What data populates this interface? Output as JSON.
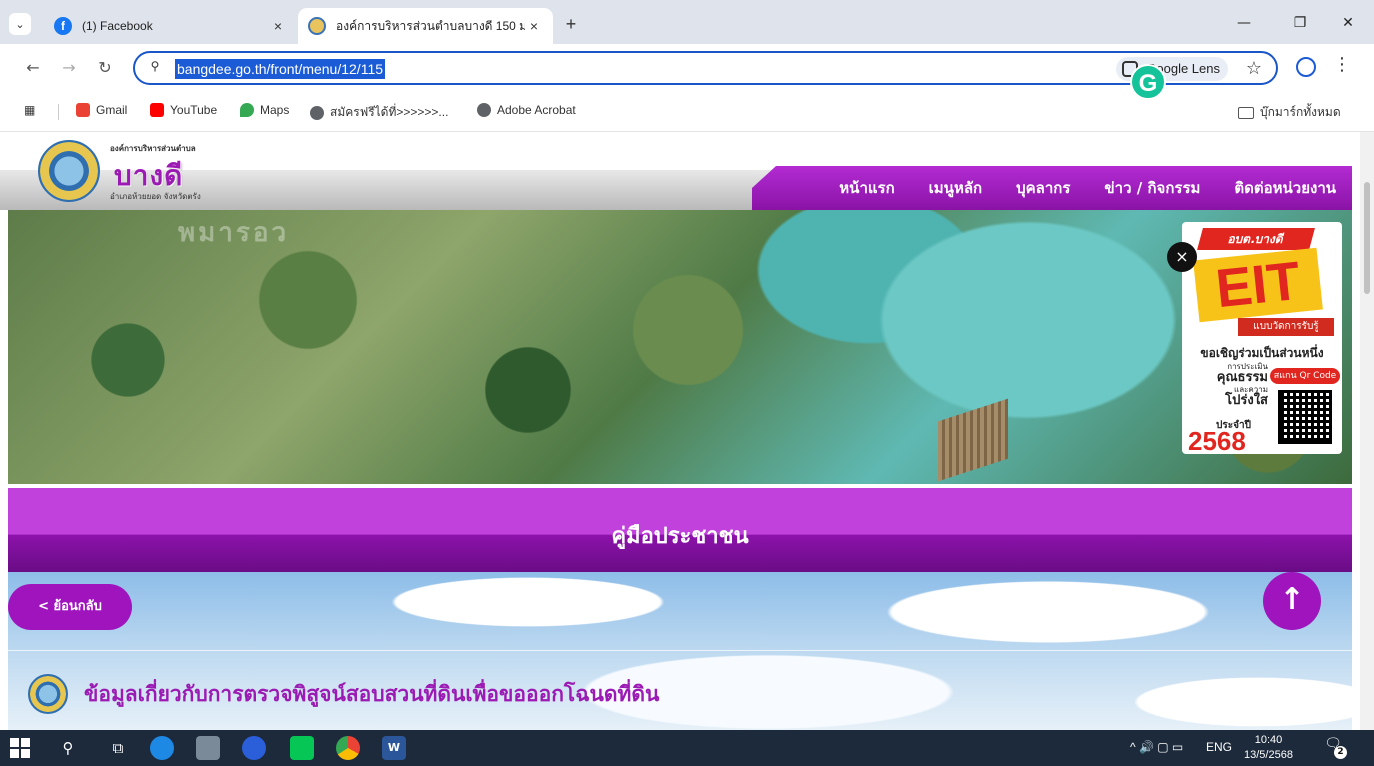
{
  "browser": {
    "tabs": [
      {
        "title": "(1) Facebook",
        "favicon": "facebook-icon",
        "active": false
      },
      {
        "title": "องค์การบริหารส่วนตำบลบางดี 150 ม",
        "favicon": "site-seal-icon",
        "active": true
      }
    ],
    "tab_close_glyph": "×",
    "new_tab_glyph": "+",
    "url": "bangdee.go.th/front/menu/12/115",
    "lens_label": "Google Lens",
    "bookmarks": [
      {
        "label": "Gmail",
        "color": "#ea4335"
      },
      {
        "label": "YouTube",
        "color": "#ff0000"
      },
      {
        "label": "Maps",
        "color": "#34a853"
      },
      {
        "label": "สมัครฟรีได้ที่>>>>>>...",
        "color": "#5f6368"
      },
      {
        "label": "Adobe Acrobat",
        "color": "#5f6368"
      }
    ],
    "all_bookmarks_label": "บุ๊กมาร์กทั้งหมด"
  },
  "site": {
    "logo_org": "องค์การบริหารส่วนตำบล",
    "logo_name": "บางดี",
    "logo_sub": "อำเภอห้วยยอด จังหวัดตรัง",
    "menu": [
      "หน้าแรก",
      "เมนูหลัก",
      "บุคลากร",
      "ข่าว / กิจกรรม",
      "ติดต่อหน่วยงาน"
    ],
    "accent_color": "#a014be",
    "hero_watermark": "พมารอว"
  },
  "eit_popup": {
    "tag": "อบต.บางดี",
    "big": "EIT",
    "sub": "แบบวัดการรับรู้",
    "invite": "ขอเชิญร่วมเป็นส่วนหนึ่ง",
    "line1": "การประเมิน",
    "line2": "คุณธรรม",
    "line3": "และความ",
    "line4": "โปร่งใส",
    "scan": "สแกน Qr Code",
    "year_label": "ประจำปี",
    "year": "2568",
    "close_glyph": "×"
  },
  "page": {
    "section_title": "คู่มือประชาชน",
    "back_label": "< ย้อนกลับ",
    "to_top_glyph": "↑",
    "item_title": "ข้อมูลเกี่ยวกับการตรวจพิสูจน์สอบสวนที่ดินเพื่อขอออกโฉนดที่ดิน"
  },
  "taskbar": {
    "tray_lang": "ENG",
    "time": "10:40",
    "date": "13/5/2568",
    "notifications": "2"
  }
}
